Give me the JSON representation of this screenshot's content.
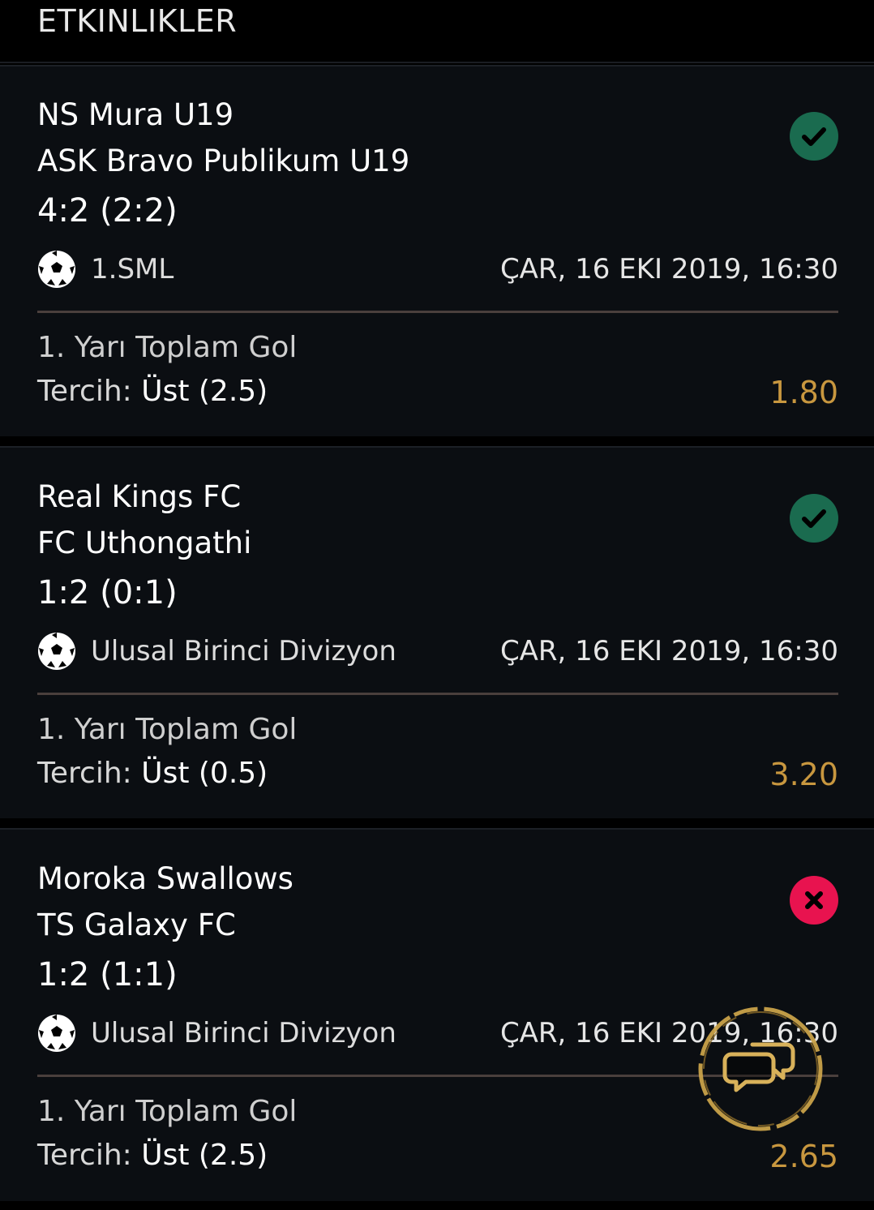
{
  "header": {
    "title": "ETKINLIKLER"
  },
  "colors": {
    "won": "#1a6b4f",
    "lost": "#e8134f",
    "odds": "#c8973f"
  },
  "events": [
    {
      "home": "NS Mura U19",
      "away": "ASK Bravo Publikum U19",
      "score": "4:2 (2:2)",
      "league": "1.SML",
      "date": "ÇAR, 16 EKI 2019, 16:30",
      "market": "1. Yarı Toplam Gol",
      "pick_prefix": "Tercih: ",
      "pick_value": "Üst (2.5)",
      "odds": "1.80",
      "status": "won",
      "status_icon": "check-icon"
    },
    {
      "home": "Real Kings FC",
      "away": "FC Uthongathi",
      "score": "1:2 (0:1)",
      "league": "Ulusal Birinci Divizyon",
      "date": "ÇAR, 16 EKI 2019, 16:30",
      "market": "1. Yarı Toplam Gol",
      "pick_prefix": "Tercih: ",
      "pick_value": "Üst (0.5)",
      "odds": "3.20",
      "status": "won",
      "status_icon": "check-icon"
    },
    {
      "home": "Moroka Swallows",
      "away": "TS Galaxy FC",
      "score": "1:2 (1:1)",
      "league": "Ulusal Birinci Divizyon",
      "date": "ÇAR, 16 EKI 2019, 16:30",
      "market": "1. Yarı Toplam Gol",
      "pick_prefix": "Tercih: ",
      "pick_value": "Üst (2.5)",
      "odds": "2.65",
      "status": "lost",
      "status_icon": "close-icon"
    }
  ],
  "fab": {
    "icon": "chat-icon"
  }
}
